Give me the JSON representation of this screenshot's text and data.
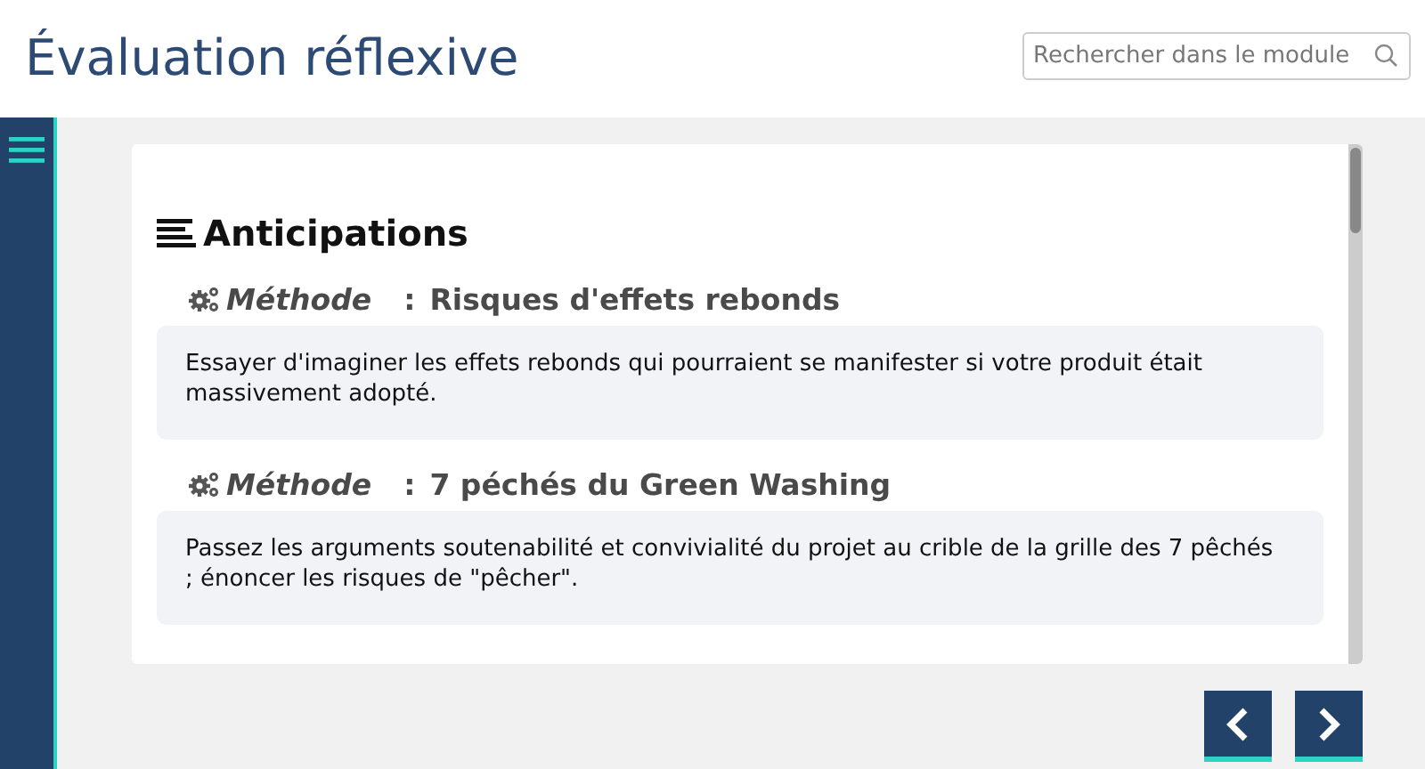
{
  "header": {
    "title": "Évaluation réflexive",
    "search": {
      "placeholder": "Rechercher dans le module"
    }
  },
  "section": {
    "title": "Anticipations",
    "methods": [
      {
        "label": "Méthode",
        "separator": ":",
        "title": "Risques d'effets rebonds",
        "text": "Essayer d'imaginer les effets rebonds qui pourraient se manifester si votre produit était massivement adopté."
      },
      {
        "label": "Méthode",
        "separator": ":",
        "title": "7 péchés du Green Washing",
        "text": "Passez les arguments soutenabilité et convivialité du projet au crible de la grille des 7 pêchés ; énoncer les risques de \"pêcher\"."
      }
    ]
  },
  "navigation": [
    {
      "kind": "previous"
    },
    {
      "kind": "next"
    }
  ]
}
